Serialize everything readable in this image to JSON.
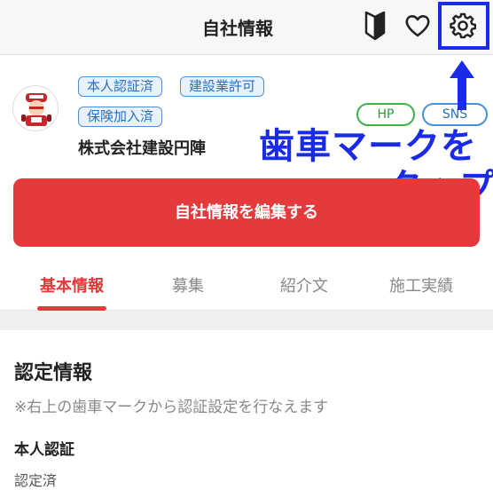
{
  "header": {
    "title": "自社情報"
  },
  "profile": {
    "badges": [
      "本人認証済",
      "建設業許可",
      "保険加入済"
    ],
    "company_name": "株式会社建設円陣",
    "hp_label": "HP",
    "sns_label": "SNS"
  },
  "annotation": {
    "line1": "歯車マークを",
    "line2": "タップ",
    "color": "#1a2be8"
  },
  "edit_button": {
    "label": "自社情報を編集する",
    "color": "#e53a3c"
  },
  "tabs": [
    {
      "label": "基本情報",
      "active": true
    },
    {
      "label": "募集",
      "active": false
    },
    {
      "label": "紹介文",
      "active": false
    },
    {
      "label": "施工実績",
      "active": false
    }
  ],
  "certification": {
    "title": "認定情報",
    "note": "※右上の歯車マークから認証設定を行なえます",
    "identity_title": "本人認証",
    "identity_value": "認定済"
  },
  "icons": {
    "beginner": "beginner-mark-icon",
    "heart": "heart-icon",
    "gear": "gear-icon",
    "arrow": "arrow-up-icon"
  }
}
